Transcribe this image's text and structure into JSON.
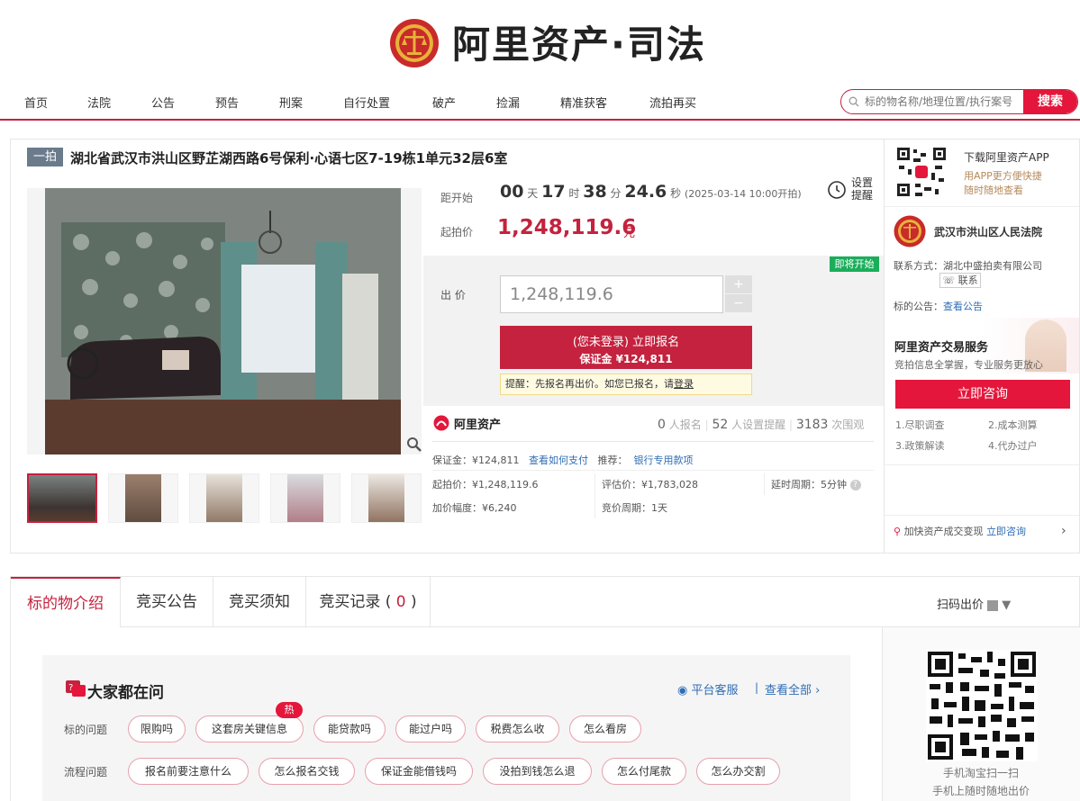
{
  "brand": {
    "title": "阿里资产·司法"
  },
  "nav": {
    "items": [
      "首页",
      "法院",
      "公告",
      "预告",
      "刑案",
      "自行处置",
      "破产",
      "捡漏",
      "精准获客",
      "流拍再买"
    ]
  },
  "search": {
    "placeholder": "标的物名称/地理位置/执行案号",
    "button": "搜索"
  },
  "item": {
    "tag": "一拍",
    "title": "湖北省武汉市洪山区野芷湖西路6号保利·心语七区7-19栋1单元32层6室"
  },
  "countdown": {
    "label": "距开始",
    "days": "00",
    "days_unit": "天",
    "hours": "17",
    "hours_unit": "时",
    "minutes": "38",
    "minutes_unit": "分",
    "seconds": "24.6",
    "seconds_unit": "秒",
    "start_time": "(2025-03-14 10:00开拍)"
  },
  "remind": {
    "label": "设置提醒"
  },
  "price": {
    "label": "起拍价",
    "value": "1,248,119.6",
    "unit": "元"
  },
  "bid": {
    "badge": "即将开始",
    "label": "出 价",
    "input_value": "1,248,119.6",
    "plus": "+",
    "minus": "−",
    "signup_line1": "(您未登录) 立即报名",
    "signup_line2": "保证金 ¥124,811",
    "tip_prefix": "提醒：先报名再出价。如您已报名，请",
    "tip_link": "登录"
  },
  "stats": {
    "logo": "阿里资产",
    "signups": "0",
    "signups_label": "人报名",
    "reminders": "52",
    "reminders_label": "人设置提醒",
    "views": "3183",
    "views_label": "次围观"
  },
  "info": {
    "deposit": "保证金：¥124,811",
    "how_pay": "查看如何支付",
    "recommend": "推荐：",
    "bank": "银行专用款项",
    "start_price": "起拍价：¥1,248,119.6",
    "eval_price": "评估价：¥1,783,028",
    "delay": "延时周期：5分钟",
    "increment": "加价幅度：¥6,240",
    "period": "竞价周期：1天"
  },
  "sidebar": {
    "app_title": "下载阿里资产APP",
    "app_desc1": "用APP更方便快捷",
    "app_desc2": "随时随地查看",
    "court": "武汉市洪山区人民法院",
    "contact_label": "联系方式：",
    "contact_company": "湖北中盛拍卖有限公司",
    "contact_btn": "联系",
    "notice_label": "标的公告：",
    "notice_link": "查看公告",
    "svc_title": "阿里资产交易服务",
    "svc_desc": "竞拍信息全掌握，专业服务更放心",
    "consult": "立即咨询",
    "svc_items": [
      "1.尽职调查",
      "2.成本测算",
      "3.政策解读",
      "4.代办过户"
    ],
    "speed_text": "加快资产成交变现",
    "speed_link": "立即咨询"
  },
  "tabs": {
    "items": [
      "标的物介绍",
      "竞买公告",
      "竞买须知",
      "竞买记录"
    ],
    "record_count": "0",
    "scan_bid": "扫码出价"
  },
  "faq": {
    "title": "大家都在问",
    "service": "平台客服",
    "view_all": "查看全部",
    "hot": "热",
    "row1_label": "标的问题",
    "row1": [
      "限购吗",
      "这套房关键信息",
      "能贷款吗",
      "能过户吗",
      "税费怎么收",
      "怎么看房"
    ],
    "row2_label": "流程问题",
    "row2": [
      "报名前要注意什么",
      "怎么报名交钱",
      "保证金能借钱吗",
      "没拍到钱怎么退",
      "怎么付尾款",
      "怎么办交割"
    ]
  },
  "qr": {
    "cap1": "手机淘宝扫一扫",
    "cap2": "手机上随时随地出价"
  },
  "colors": {
    "brand_red": "#c4223e",
    "button_red": "#e4163b",
    "link_blue": "#2f6db5",
    "badge_green": "#1aae5a"
  }
}
